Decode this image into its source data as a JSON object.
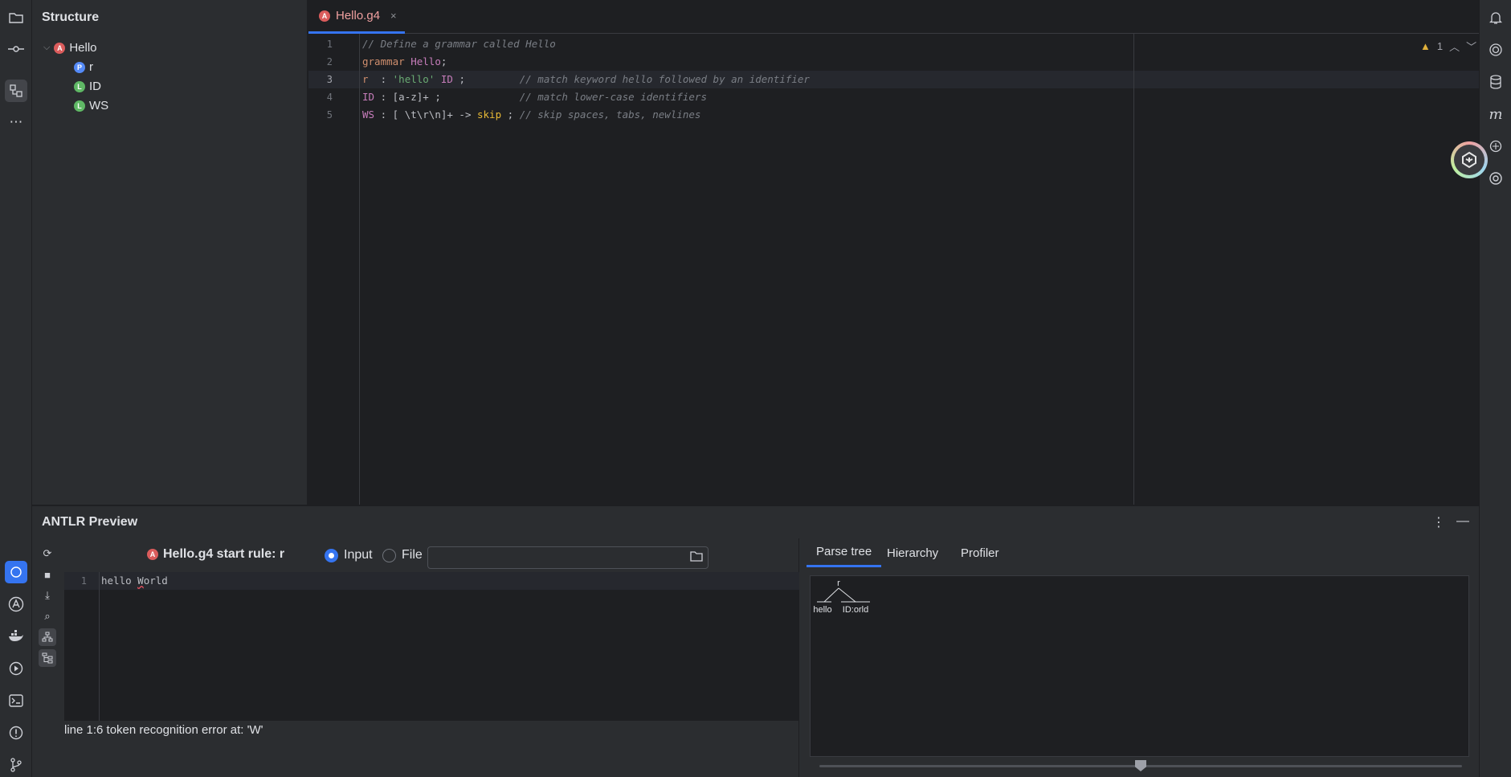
{
  "structure": {
    "title": "Structure",
    "root": {
      "badge": "A",
      "label": "Hello"
    },
    "children": [
      {
        "badge": "P",
        "label": "r"
      },
      {
        "badge": "L",
        "label": "ID"
      },
      {
        "badge": "L",
        "label": "WS"
      }
    ]
  },
  "editor": {
    "tab": {
      "label": "Hello.g4",
      "close": "×"
    },
    "warnings": "1",
    "lines": [
      {
        "n": "1",
        "parts": [
          {
            "c": "cm",
            "t": "// Define a grammar called Hello"
          }
        ]
      },
      {
        "n": "2",
        "parts": [
          {
            "c": "kw",
            "t": "grammar "
          },
          {
            "c": "tok",
            "t": "Hello"
          },
          {
            "c": "pl",
            "t": ";"
          }
        ]
      },
      {
        "n": "3",
        "parts": [
          {
            "c": "kw",
            "t": "r"
          },
          {
            "c": "pl",
            "t": "  : "
          },
          {
            "c": "str",
            "t": "'hello'"
          },
          {
            "c": "pl",
            "t": " "
          },
          {
            "c": "tok",
            "t": "ID"
          },
          {
            "c": "pl",
            "t": " ;         "
          },
          {
            "c": "cm",
            "t": "// match keyword hello followed by an identifier"
          }
        ]
      },
      {
        "n": "4",
        "parts": [
          {
            "c": "tok",
            "t": "ID"
          },
          {
            "c": "pl",
            "t": " : [a-z]+ ;             "
          },
          {
            "c": "cm",
            "t": "// match lower-case identifiers"
          }
        ]
      },
      {
        "n": "5",
        "parts": [
          {
            "c": "tok",
            "t": "WS"
          },
          {
            "c": "pl",
            "t": " : [ \\t\\r\\n]+ -> "
          },
          {
            "c": "sk",
            "t": "skip"
          },
          {
            "c": "pl",
            "t": " ; "
          },
          {
            "c": "cm",
            "t": "// skip spaces, tabs, newlines"
          }
        ]
      }
    ]
  },
  "preview": {
    "title": "ANTLR Preview",
    "start_rule": "Hello.g4 start rule: r",
    "radio_input": "Input",
    "radio_file": "File",
    "input_line_number": "1",
    "input_before": "hello ",
    "input_error_char": "W",
    "input_after": "orld",
    "status": "line 1:6 token recognition error at: 'W'",
    "tabs": [
      "Parse tree",
      "Hierarchy",
      "Profiler"
    ],
    "parse_tree": {
      "root": "r",
      "children": [
        "hello",
        "ID:orld"
      ]
    },
    "zoom_fraction": 0.5
  }
}
